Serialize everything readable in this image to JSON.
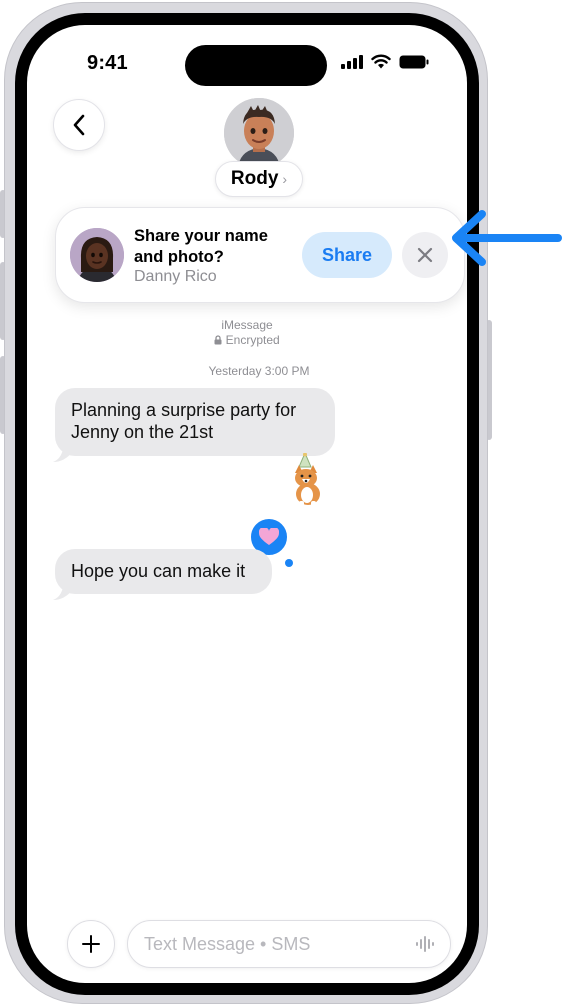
{
  "status_bar": {
    "time": "9:41"
  },
  "header": {
    "back_icon": "chevron-left-icon",
    "contact_name": "Rody",
    "chevron": "›"
  },
  "share_banner": {
    "title": "Share your name and photo?",
    "subtitle": "Danny Rico",
    "share_label": "Share",
    "close_icon": "close-icon"
  },
  "conversation": {
    "service": "iMessage",
    "encryption": "Encrypted",
    "timestamp": "Yesterday 3:00 PM",
    "messages": [
      {
        "text": "Planning a surprise party for Jenny on the 21st"
      },
      {
        "text": "Hope you can make it"
      }
    ],
    "sticker": "corgi-party-hat-sticker",
    "tapback": "heart-tapback"
  },
  "input_bar": {
    "plus_icon": "plus-icon",
    "placeholder": "Text Message • SMS",
    "voice_icon": "waveform-icon"
  },
  "colors": {
    "accent": "#1a7cf2",
    "bubble_gray": "#e9e9eb",
    "callout_arrow": "#1a84f5"
  }
}
